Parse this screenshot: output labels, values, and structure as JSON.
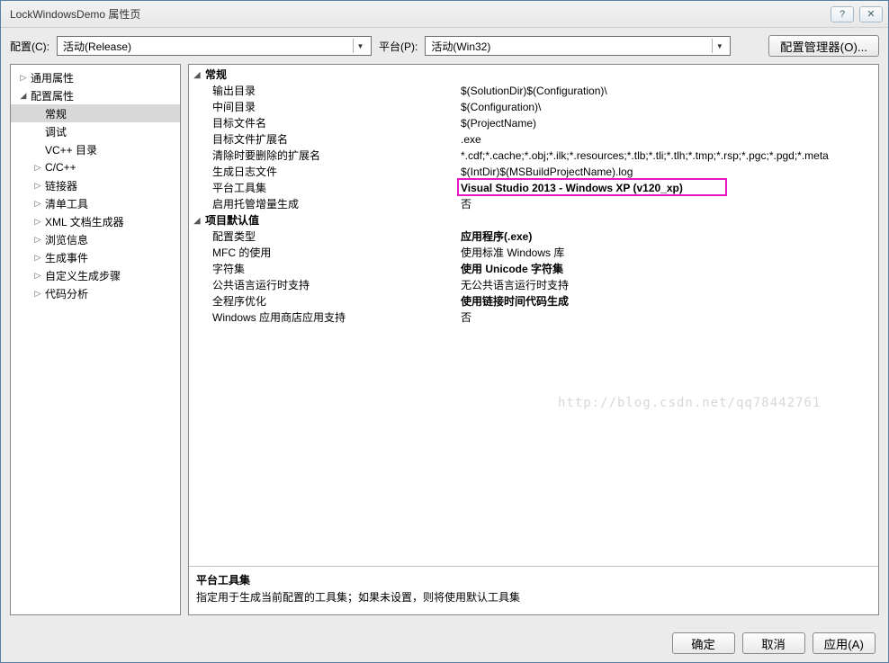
{
  "window": {
    "title": "LockWindowsDemo 属性页",
    "help_icon": "?",
    "close_icon": "✕"
  },
  "topbar": {
    "config_label": "配置(C):",
    "config_value": "活动(Release)",
    "platform_label": "平台(P):",
    "platform_value": "活动(Win32)",
    "config_manager_btn": "配置管理器(O)..."
  },
  "tree": {
    "items": [
      {
        "label": "通用属性",
        "expand": "▷",
        "depth": 0
      },
      {
        "label": "配置属性",
        "expand": "◢",
        "depth": 0
      },
      {
        "label": "常规",
        "expand": "",
        "depth": 1,
        "selected": true
      },
      {
        "label": "调试",
        "expand": "",
        "depth": 1
      },
      {
        "label": "VC++ 目录",
        "expand": "",
        "depth": 1
      },
      {
        "label": "C/C++",
        "expand": "▷",
        "depth": 1
      },
      {
        "label": "链接器",
        "expand": "▷",
        "depth": 1
      },
      {
        "label": "清单工具",
        "expand": "▷",
        "depth": 1
      },
      {
        "label": "XML 文档生成器",
        "expand": "▷",
        "depth": 1
      },
      {
        "label": "浏览信息",
        "expand": "▷",
        "depth": 1
      },
      {
        "label": "生成事件",
        "expand": "▷",
        "depth": 1
      },
      {
        "label": "自定义生成步骤",
        "expand": "▷",
        "depth": 1
      },
      {
        "label": "代码分析",
        "expand": "▷",
        "depth": 1
      }
    ]
  },
  "grid": {
    "groups": [
      {
        "name": "常规",
        "props": [
          {
            "label": "输出目录",
            "value": "$(SolutionDir)$(Configuration)\\",
            "bold": false
          },
          {
            "label": "中间目录",
            "value": "$(Configuration)\\",
            "bold": false
          },
          {
            "label": "目标文件名",
            "value": "$(ProjectName)",
            "bold": false
          },
          {
            "label": "目标文件扩展名",
            "value": ".exe",
            "bold": false
          },
          {
            "label": "清除时要删除的扩展名",
            "value": "*.cdf;*.cache;*.obj;*.ilk;*.resources;*.tlb;*.tli;*.tlh;*.tmp;*.rsp;*.pgc;*.pgd;*.meta",
            "bold": false
          },
          {
            "label": "生成日志文件",
            "value": "$(IntDir)$(MSBuildProjectName).log",
            "bold": false
          },
          {
            "label": "平台工具集",
            "value": "Visual Studio 2013 - Windows XP (v120_xp)",
            "bold": true,
            "highlight": true
          },
          {
            "label": "启用托管增量生成",
            "value": "否",
            "bold": false
          }
        ]
      },
      {
        "name": "项目默认值",
        "props": [
          {
            "label": "配置类型",
            "value": "应用程序(.exe)",
            "bold": true
          },
          {
            "label": "MFC 的使用",
            "value": "使用标准 Windows 库",
            "bold": false
          },
          {
            "label": "字符集",
            "value": "使用 Unicode 字符集",
            "bold": true
          },
          {
            "label": "公共语言运行时支持",
            "value": "无公共语言运行时支持",
            "bold": false
          },
          {
            "label": "全程序优化",
            "value": "使用链接时间代码生成",
            "bold": true
          },
          {
            "label": "Windows 应用商店应用支持",
            "value": "否",
            "bold": false
          }
        ]
      }
    ]
  },
  "description": {
    "title": "平台工具集",
    "text": "指定用于生成当前配置的工具集；如果未设置，则将使用默认工具集"
  },
  "footer": {
    "ok": "确定",
    "cancel": "取消",
    "apply": "应用(A)"
  },
  "watermark": "http://blog.csdn.net/qq78442761"
}
